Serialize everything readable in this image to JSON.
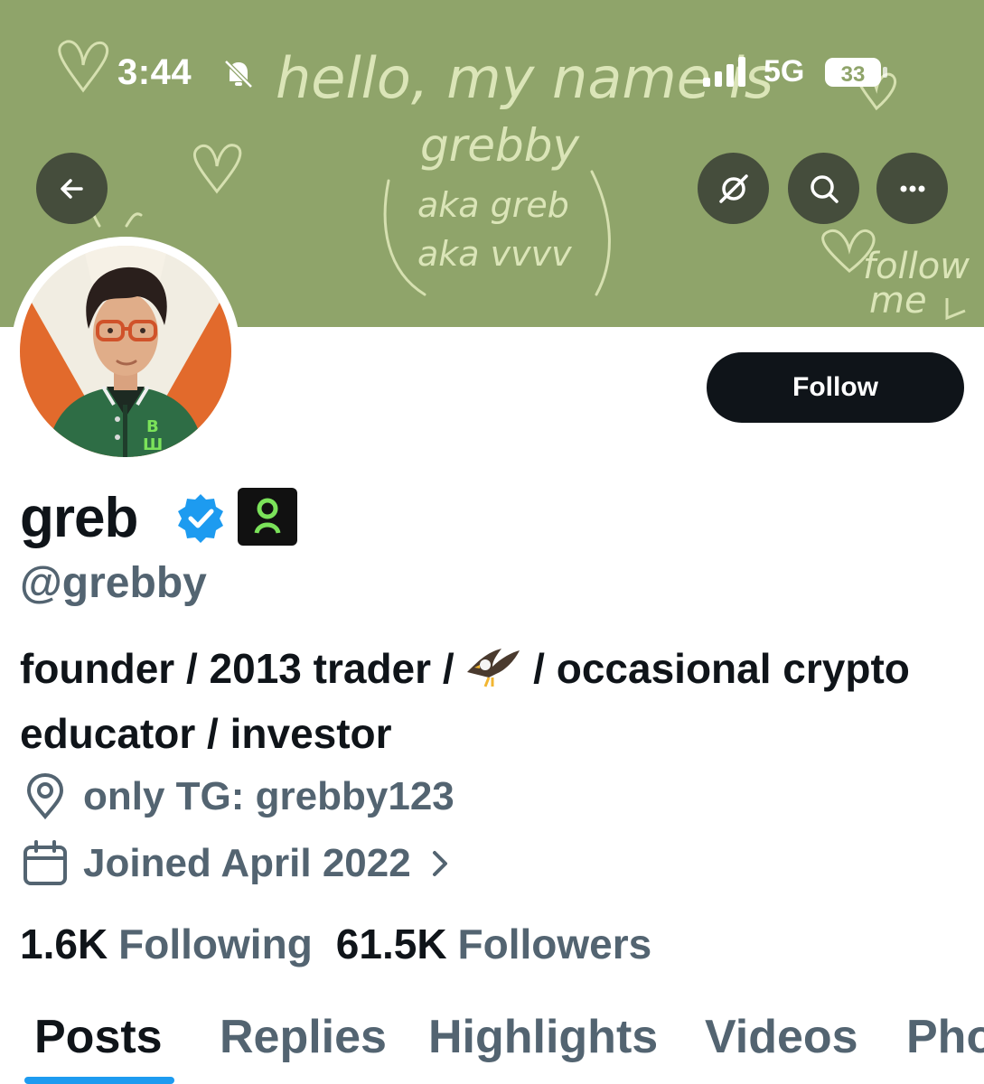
{
  "status_bar": {
    "time": "3:44",
    "network": "5G",
    "battery": "33"
  },
  "banner": {
    "doodle_lines": [
      "hello, my name is",
      "grebby",
      "aka greb",
      "aka vvvv",
      "follow",
      "me"
    ],
    "background_color": "#8fa46a"
  },
  "header_buttons": {
    "back_icon": "arrow-left-icon",
    "grok_icon": "grok-icon",
    "search_icon": "search-icon",
    "more_icon": "more-horizontal-icon"
  },
  "profile": {
    "display_name": "greb",
    "handle": "@grebby",
    "verified": true,
    "follow_label": "Follow",
    "bio_part1": "founder / 2013 trader / ",
    "bio_emoji": "eagle",
    "bio_part2": " / occasional crypto educator / investor",
    "location": "only TG: grebby123",
    "joined": "Joined April 2022"
  },
  "stats": {
    "following_count": "1.6K",
    "following_label": "Following",
    "followers_count": "61.5K",
    "followers_label": "Followers"
  },
  "tabs": {
    "posts": "Posts",
    "replies": "Replies",
    "highlights": "Highlights",
    "videos": "Videos",
    "photos": "Photos",
    "active": "posts"
  },
  "colors": {
    "accent": "#1d9bf0",
    "text_primary": "#0f1419",
    "text_secondary": "#536471",
    "verified": "#1d9bf0"
  }
}
